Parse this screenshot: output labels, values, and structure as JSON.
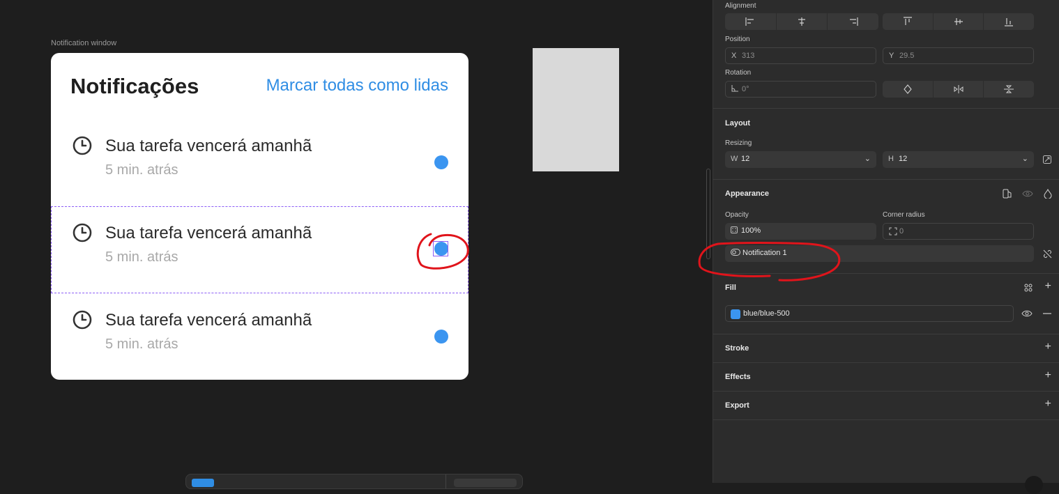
{
  "canvas": {
    "frame_label": "Notification window",
    "card": {
      "title": "Notificações",
      "mark_all": "Marcar todas como lidas",
      "items": [
        {
          "title": "Sua tarefa vencerá amanhã",
          "time": "5 min. atrás"
        },
        {
          "title": "Sua tarefa vencerá amanhã",
          "time": "5 min. atrás"
        },
        {
          "title": "Sua tarefa vencerá amanhã",
          "time": "5 min. atrás"
        }
      ],
      "dot_color": "#3b95f0"
    }
  },
  "panel": {
    "alignment": {
      "label": "Alignment"
    },
    "position": {
      "label": "Position",
      "x_prefix": "X",
      "x": "313",
      "y_prefix": "Y",
      "y": "29.5"
    },
    "rotation": {
      "label": "Rotation",
      "value": "0°"
    },
    "layout": {
      "label": "Layout",
      "resizing_label": "Resizing",
      "w_prefix": "W",
      "w": "12",
      "h_prefix": "H",
      "h": "12"
    },
    "appearance": {
      "label": "Appearance",
      "opacity_label": "Opacity",
      "opacity": "100%",
      "corner_radius_label": "Corner radius",
      "corner_radius": "0",
      "variable": "Notification 1"
    },
    "fill": {
      "label": "Fill",
      "name": "blue/blue-500",
      "color": "#3b95f0"
    },
    "stroke": {
      "label": "Stroke"
    },
    "effects": {
      "label": "Effects"
    },
    "export": {
      "label": "Export"
    }
  },
  "colors": {
    "accent": "#2f8de4",
    "annotation": "#e0141b",
    "selection": "#8b5cf6"
  }
}
